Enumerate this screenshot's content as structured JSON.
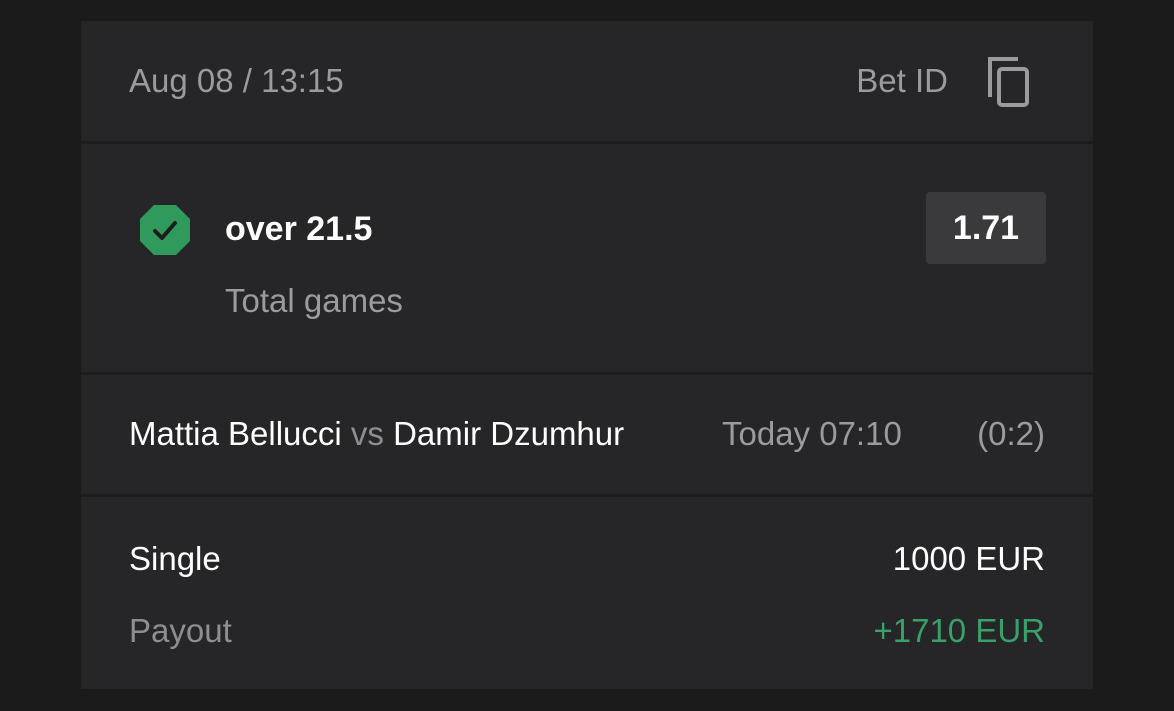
{
  "header": {
    "date_time": "Aug 08 / 13:15",
    "bet_id_label": "Bet ID",
    "copy_icon": "copy-icon"
  },
  "selection": {
    "status_icon": "check-octagon-icon",
    "status_color": "#2f9a5c",
    "name": "over 21.5",
    "market": "Total games",
    "odds": "1.71"
  },
  "match": {
    "player1": "Mattia Bellucci",
    "vs": "vs",
    "player2": "Damir Dzumhur",
    "time": "Today 07:10",
    "score": "(0:2)"
  },
  "summary": {
    "bet_type": "Single",
    "stake": "1000 EUR",
    "payout_label": "Payout",
    "payout_value": "+1710 EUR",
    "payout_color": "#3aa06a"
  }
}
